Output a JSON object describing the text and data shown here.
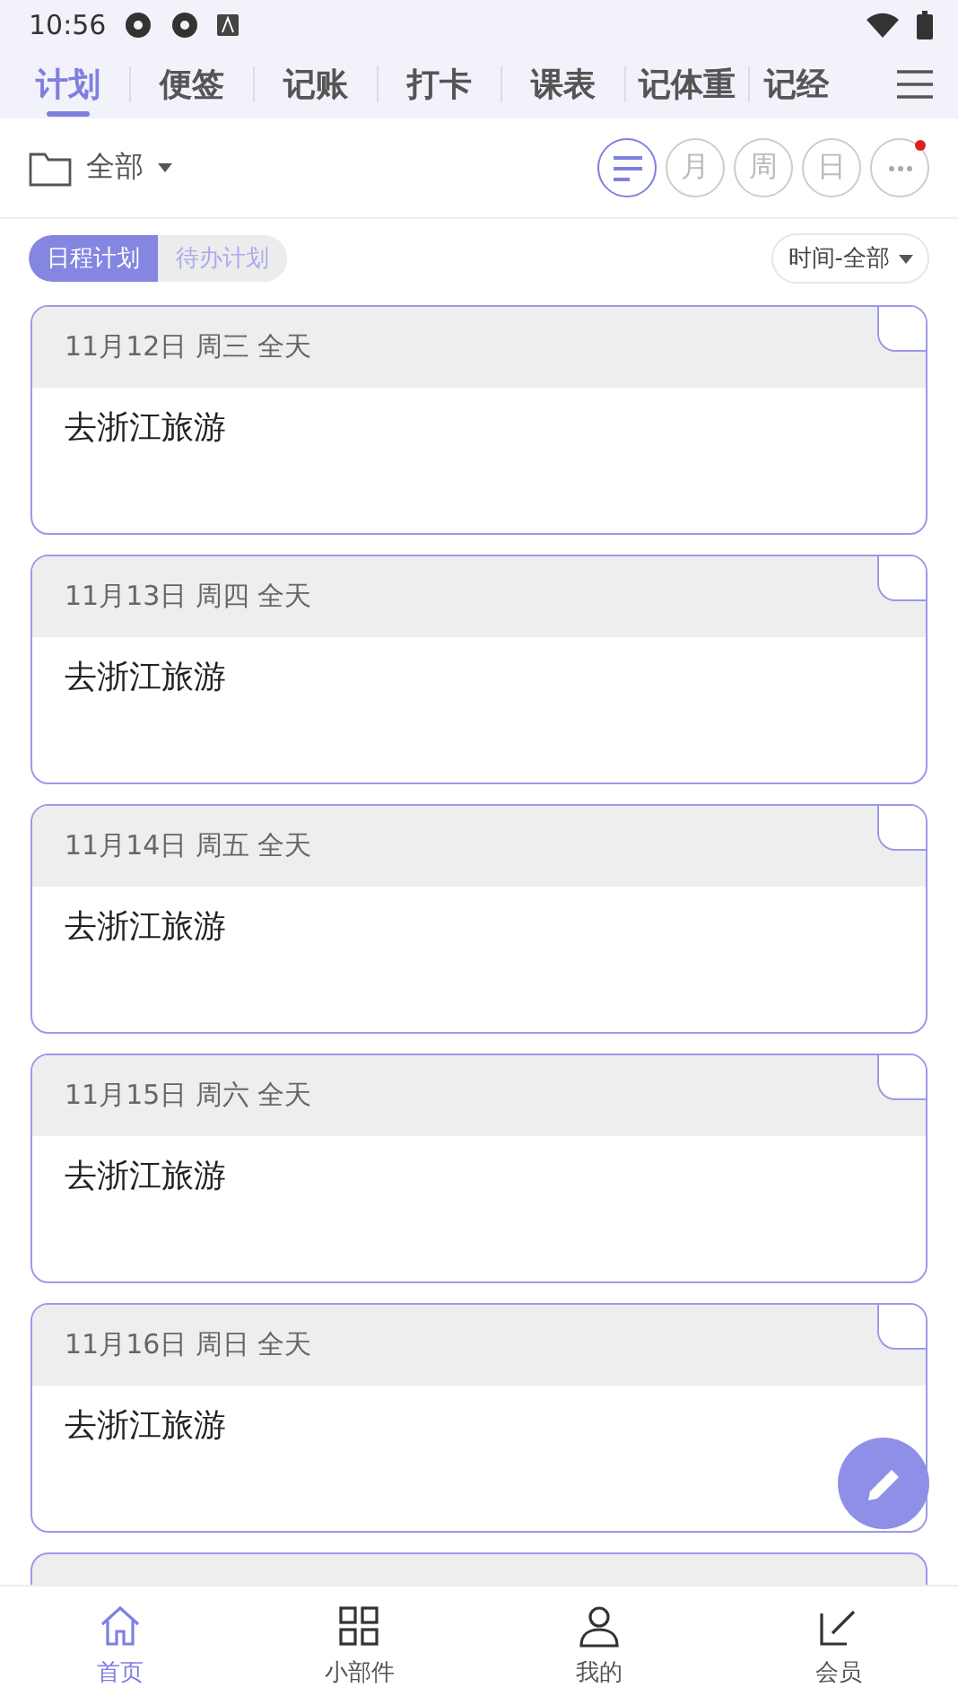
{
  "status_bar": {
    "time": "10:56"
  },
  "tabs": [
    {
      "label": "计划",
      "selected": true
    },
    {
      "label": "便签",
      "selected": false
    },
    {
      "label": "记账",
      "selected": false
    },
    {
      "label": "打卡",
      "selected": false
    },
    {
      "label": "课表",
      "selected": false
    },
    {
      "label": "记体重",
      "selected": false
    },
    {
      "label": "记经",
      "selected": false
    }
  ],
  "toolbar": {
    "folder": "全部",
    "views": [
      {
        "kind": "list",
        "selected": true
      },
      {
        "kind": "text",
        "label": "月",
        "selected": false
      },
      {
        "kind": "text",
        "label": "周",
        "selected": false
      },
      {
        "kind": "text",
        "label": "日",
        "selected": false
      },
      {
        "kind": "more",
        "selected": false,
        "badge": true
      }
    ]
  },
  "segments": [
    {
      "label": "日程计划",
      "selected": true
    },
    {
      "label": "待办计划",
      "selected": false
    }
  ],
  "time_filter": "时间-全部",
  "plans": [
    {
      "date": "11月12日 周三 全天",
      "title": "去浙江旅游"
    },
    {
      "date": "11月13日 周四 全天",
      "title": "去浙江旅游"
    },
    {
      "date": "11月14日 周五 全天",
      "title": "去浙江旅游"
    },
    {
      "date": "11月15日 周六 全天",
      "title": "去浙江旅游"
    },
    {
      "date": "11月16日 周日 全天",
      "title": "去浙江旅游"
    }
  ],
  "bottom_nav": [
    {
      "label": "首页",
      "kind": "home",
      "selected": true
    },
    {
      "label": "小部件",
      "kind": "grid",
      "selected": false
    },
    {
      "label": "我的",
      "kind": "user",
      "selected": false
    },
    {
      "label": "会员",
      "kind": "vip",
      "selected": false
    }
  ]
}
